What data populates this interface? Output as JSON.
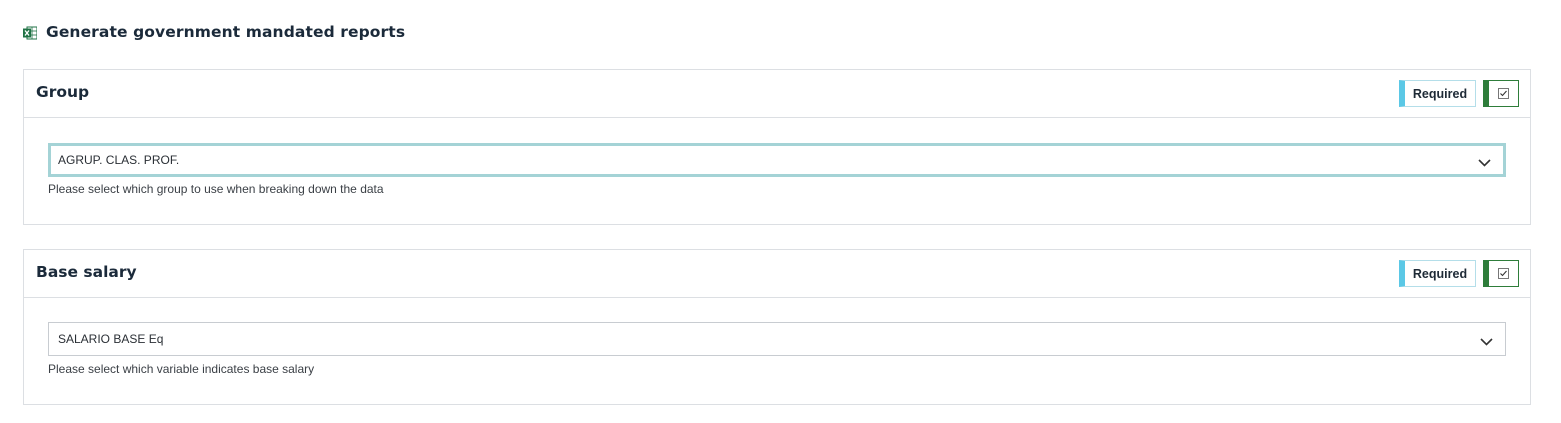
{
  "header": {
    "icon": "excel-icon",
    "title": "Generate government mandated reports"
  },
  "sections": [
    {
      "title": "Group",
      "required_label": "Required",
      "enabled": true,
      "select_value": "AGRUP. CLAS. PROF.",
      "help_text": "Please select which group to use when breaking down the data",
      "focused": true
    },
    {
      "title": "Base salary",
      "required_label": "Required",
      "enabled": true,
      "select_value": "SALARIO BASE Eq",
      "help_text": "Please select which variable indicates base salary",
      "focused": false
    }
  ],
  "colors": {
    "required_accent": "#5bc8e6",
    "toggle_accent": "#2e7d3a",
    "focus_border": "#a4d3d6",
    "excel_green": "#1f7244"
  }
}
